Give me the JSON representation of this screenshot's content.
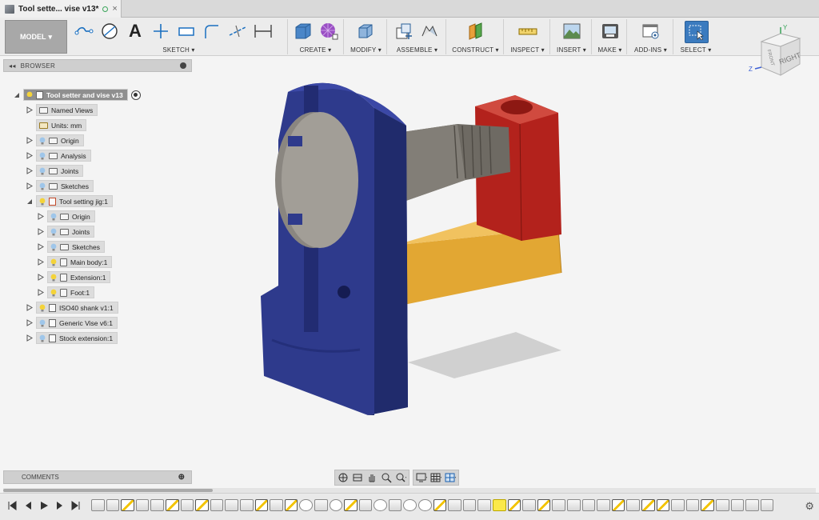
{
  "tab": {
    "title": "Tool sette... vise v13*"
  },
  "toolbar": {
    "workspace": "MODEL",
    "groups": {
      "sketch": "SKETCH",
      "create": "CREATE",
      "modify": "MODIFY",
      "assemble": "ASSEMBLE",
      "construct": "CONSTRUCT",
      "inspect": "INSPECT",
      "insert": "INSERT",
      "make": "MAKE",
      "addins": "ADD-INS",
      "select": "SELECT"
    }
  },
  "viewcube": {
    "face_right": "RIGHT",
    "face_front": "FRONT",
    "axis_y": "Y",
    "axis_z": "Z"
  },
  "browser": {
    "title": "BROWSER",
    "root": "Tool setter and vise v13",
    "items": [
      {
        "label": "Named Views"
      },
      {
        "label": "Units: mm"
      },
      {
        "label": "Origin"
      },
      {
        "label": "Analysis"
      },
      {
        "label": "Joints"
      },
      {
        "label": "Sketches"
      },
      {
        "label": "Tool setting jig:1"
      },
      {
        "label": "Origin"
      },
      {
        "label": "Joints"
      },
      {
        "label": "Sketches"
      },
      {
        "label": "Main body:1"
      },
      {
        "label": "Extension:1"
      },
      {
        "label": "Foot:1"
      },
      {
        "label": "ISO40 shank v1:1"
      },
      {
        "label": "Generic Vise v6:1"
      },
      {
        "label": "Stock extension:1"
      }
    ]
  },
  "comments": {
    "title": "COMMENTS"
  },
  "colors": {
    "blue_body": "#2e3a8c",
    "red_block": "#b3221c",
    "yellow_bar": "#e2a733",
    "steel": "#6e6a63",
    "select_accent": "#3b7bbf"
  }
}
